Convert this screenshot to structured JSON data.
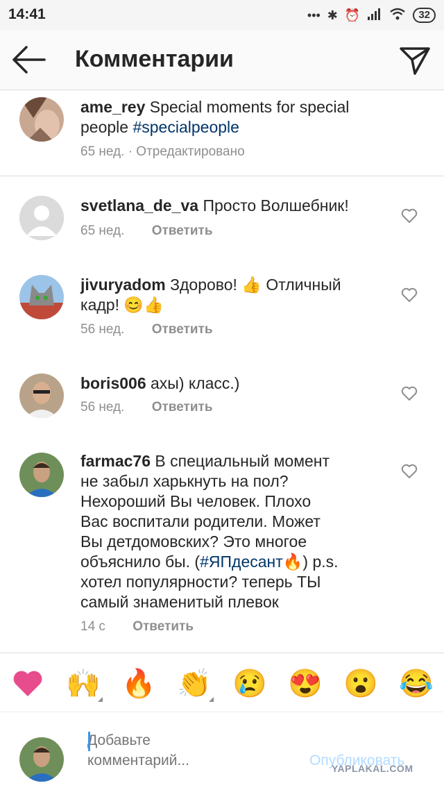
{
  "status_bar": {
    "time": "14:41",
    "battery": "32"
  },
  "header": {
    "title": "Комментарии"
  },
  "caption": {
    "username": "ame_rey",
    "text": "Special moments for special people",
    "hashtag": "#specialpeople",
    "time": "65 нед.",
    "edited": "· Отредактировано"
  },
  "comments": [
    {
      "username": "svetlana_de_va",
      "text": "Просто Волшебник!",
      "time": "65 нед.",
      "reply": "Ответить"
    },
    {
      "username": "jivuryadom",
      "text_line1": "Здорово! 👍 Отличный",
      "text_line2": "кадр! 😊👍",
      "time": "56 нед.",
      "reply": "Ответить"
    },
    {
      "username": "boris006",
      "text": "ахы) класс.)",
      "time": "56 нед.",
      "reply": "Ответить"
    },
    {
      "username": "farmac76",
      "line1": "В специальный момент",
      "line2": "не забыл харькнуть на пол?",
      "line3": "Нехороший Вы человек. Плохо",
      "line4": "Вас воспитали родители. Может",
      "line5": "Вы детдомовских? Это многое",
      "line6_pre": "объяснило бы. (",
      "line6_tag": "#ЯПдесант",
      "line6_post": "🔥) p.s.",
      "line7": "хотел популярности?   теперь ТЫ",
      "line8": "самый  знаменитый плевок",
      "time": "14 с",
      "reply": "Ответить"
    }
  ],
  "emoji_bar": [
    "❤️",
    "🙌",
    "🔥",
    "👏",
    "😢",
    "😍",
    "😮",
    "😂"
  ],
  "composer": {
    "placeholder": "Добавьте комментарий...",
    "publish": "Опубликовать"
  },
  "watermark": "YAPLAKAL.COM",
  "colors": {
    "hashtag": "#003569",
    "meta": "#8e8e8e",
    "publish_disabled": "#b3dbff",
    "divider": "#dbdbdb"
  }
}
